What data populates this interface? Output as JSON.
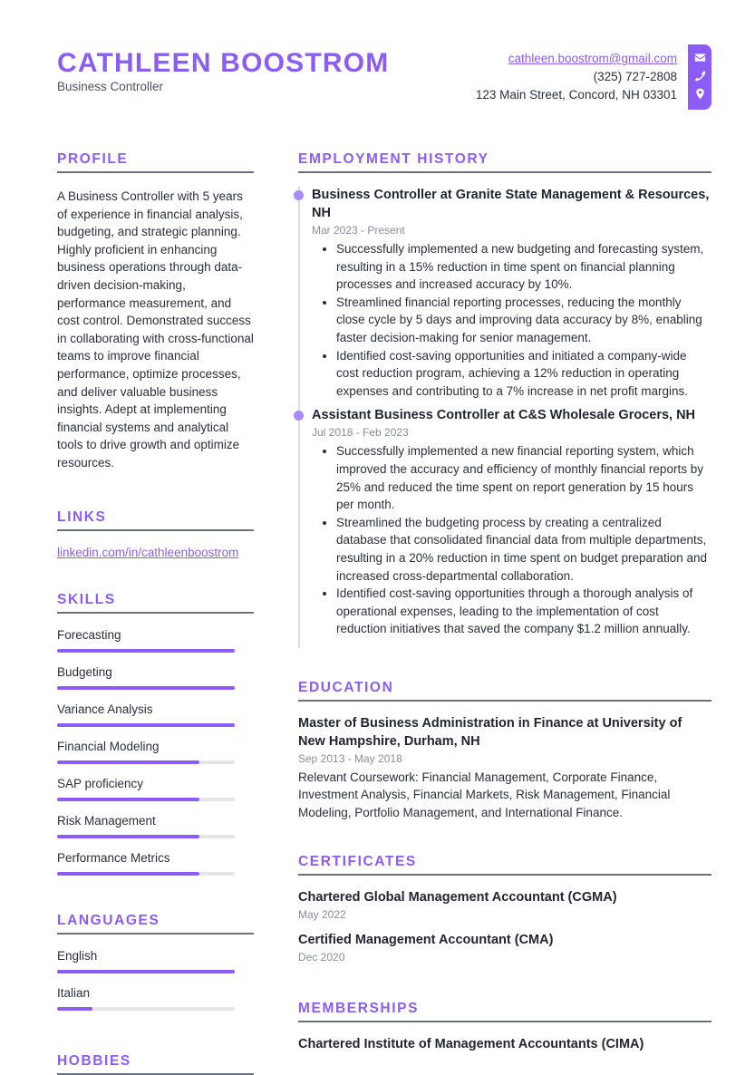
{
  "header": {
    "name": "CATHLEEN BOOSTROM",
    "role": "Business Controller",
    "email": "cathleen.boostrom@gmail.com",
    "phone": "(325) 727-2808",
    "address": "123 Main Street, Concord, NH 03301",
    "icons": [
      "envelope-icon",
      "phone-icon",
      "map-pin-icon"
    ]
  },
  "colors": {
    "accent": "#8b5cf6",
    "dot": "#a78bfa",
    "text": "#2a2f3a",
    "muted": "#888d98",
    "rule": "#6b7080"
  },
  "profile": {
    "title": "PROFILE",
    "text": "A Business Controller with 5 years of experience in financial analysis, budgeting, and strategic planning. Highly proficient in enhancing business operations through data-driven decision-making, performance measurement, and cost control. Demonstrated success in collaborating with cross-functional teams to improve financial performance, optimize processes, and deliver valuable business insights. Adept at implementing financial systems and analytical tools to drive growth and optimize resources."
  },
  "links": {
    "title": "LINKS",
    "items": [
      {
        "label": "linkedin.com/in/cathleenboostrom"
      }
    ]
  },
  "skills": {
    "title": "SKILLS",
    "items": [
      {
        "label": "Forecasting",
        "level": 1.0
      },
      {
        "label": "Budgeting",
        "level": 1.0
      },
      {
        "label": "Variance Analysis",
        "level": 1.0
      },
      {
        "label": "Financial Modeling",
        "level": 0.8
      },
      {
        "label": "SAP proficiency",
        "level": 0.8
      },
      {
        "label": "Risk Management",
        "level": 0.8
      },
      {
        "label": "Performance Metrics",
        "level": 0.8
      }
    ]
  },
  "languages": {
    "title": "LANGUAGES",
    "items": [
      {
        "label": "English",
        "level": 1.0
      },
      {
        "label": "Italian",
        "level": 0.2
      }
    ]
  },
  "hobbies": {
    "title": "HOBBIES"
  },
  "employment": {
    "title": "EMPLOYMENT HISTORY",
    "jobs": [
      {
        "title": "Business Controller at Granite State Management & Resources, NH",
        "dates": "Mar 2023 - Present",
        "bullets": [
          "Successfully implemented a new budgeting and forecasting system, resulting in a 15% reduction in time spent on financial planning processes and increased accuracy by 10%.",
          "Streamlined financial reporting processes, reducing the monthly close cycle by 5 days and improving data accuracy by 8%, enabling faster decision-making for senior management.",
          "Identified cost-saving opportunities and initiated a company-wide cost reduction program, achieving a 12% reduction in operating expenses and contributing to a 7% increase in net profit margins."
        ]
      },
      {
        "title": "Assistant Business Controller at C&S Wholesale Grocers, NH",
        "dates": "Jul 2018 - Feb 2023",
        "bullets": [
          "Successfully implemented a new financial reporting system, which improved the accuracy and efficiency of monthly financial reports by 25% and reduced the time spent on report generation by 15 hours per month.",
          "Streamlined the budgeting process by creating a centralized database that consolidated financial data from multiple departments, resulting in a 20% reduction in time spent on budget preparation and increased cross-departmental collaboration.",
          "Identified cost-saving opportunities through a thorough analysis of operational expenses, leading to the implementation of cost reduction initiatives that saved the company $1.2 million annually."
        ]
      }
    ]
  },
  "education": {
    "title": "EDUCATION",
    "items": [
      {
        "title": "Master of Business Administration in Finance at University of New Hampshire, Durham, NH",
        "dates": "Sep 2013 - May 2018",
        "description": "Relevant Coursework: Financial Management, Corporate Finance, Investment Analysis, Financial Markets, Risk Management, Financial Modeling, Portfolio Management, and International Finance."
      }
    ]
  },
  "certificates": {
    "title": "CERTIFICATES",
    "items": [
      {
        "title": "Chartered Global Management Accountant (CGMA)",
        "date": "May 2022"
      },
      {
        "title": "Certified Management Accountant (CMA)",
        "date": "Dec 2020"
      }
    ]
  },
  "memberships": {
    "title": "MEMBERSHIPS",
    "items": [
      {
        "title": "Chartered Institute of Management Accountants (CIMA)"
      }
    ]
  }
}
